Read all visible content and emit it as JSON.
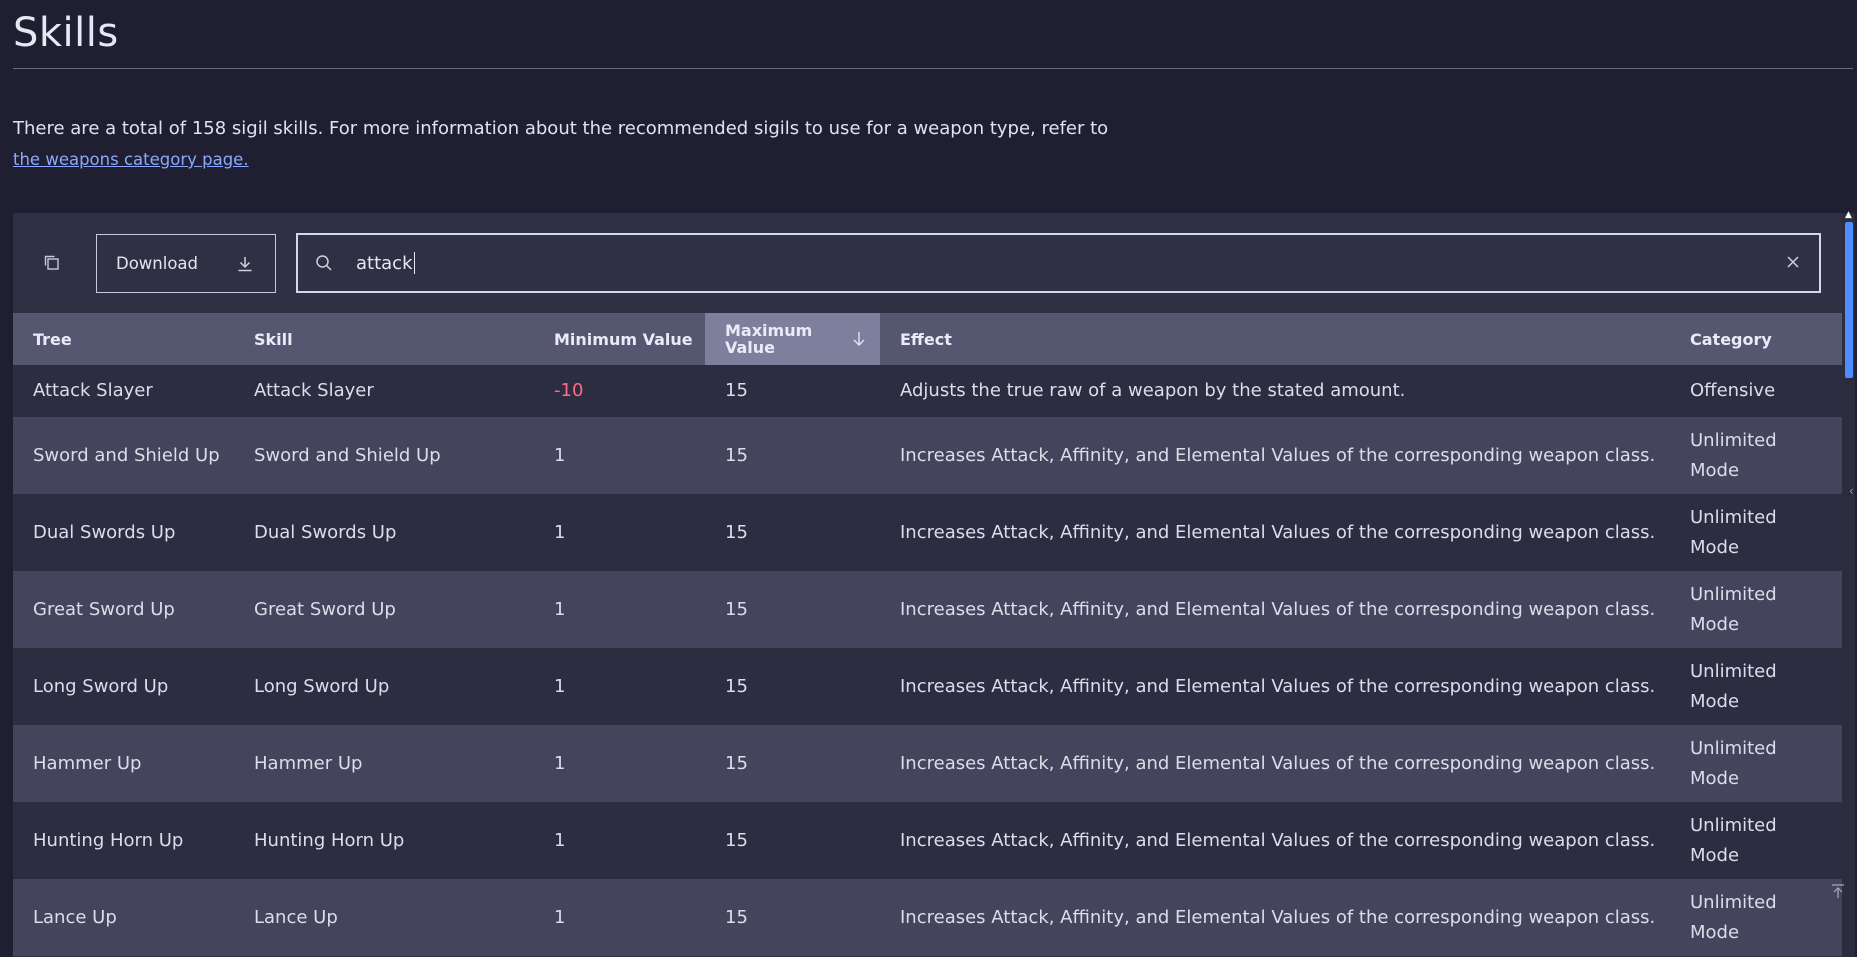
{
  "page": {
    "title": "Skills",
    "intro_text": "There are a total of 158 sigil skills. For more information about the recommended sigils to use for a weapon type, refer to",
    "intro_link": "the weapons category page."
  },
  "toolbar": {
    "download_label": "Download",
    "search_value": "attack"
  },
  "table": {
    "columns": [
      {
        "label": "Tree"
      },
      {
        "label": "Skill"
      },
      {
        "label": "Minimum Value"
      },
      {
        "label": "Maximum Value",
        "sorted": "descending"
      },
      {
        "label": "Effect"
      },
      {
        "label": "Category"
      }
    ],
    "rows": [
      {
        "tree": "Attack Slayer",
        "skill": "Attack Slayer",
        "min": "-10",
        "max": "15",
        "effect": "Adjusts the true raw of a weapon by the stated amount.",
        "category": "Offensive"
      },
      {
        "tree": "Sword and Shield Up",
        "skill": "Sword and Shield Up",
        "min": "1",
        "max": "15",
        "effect": "Increases Attack, Affinity, and Elemental Values of the corresponding weapon class.",
        "category": "Unlimited Mode"
      },
      {
        "tree": "Dual Swords Up",
        "skill": "Dual Swords Up",
        "min": "1",
        "max": "15",
        "effect": "Increases Attack, Affinity, and Elemental Values of the corresponding weapon class.",
        "category": "Unlimited Mode"
      },
      {
        "tree": "Great Sword Up",
        "skill": "Great Sword Up",
        "min": "1",
        "max": "15",
        "effect": "Increases Attack, Affinity, and Elemental Values of the corresponding weapon class.",
        "category": "Unlimited Mode"
      },
      {
        "tree": "Long Sword Up",
        "skill": "Long Sword Up",
        "min": "1",
        "max": "15",
        "effect": "Increases Attack, Affinity, and Elemental Values of the corresponding weapon class.",
        "category": "Unlimited Mode"
      },
      {
        "tree": "Hammer Up",
        "skill": "Hammer Up",
        "min": "1",
        "max": "15",
        "effect": "Increases Attack, Affinity, and Elemental Values of the corresponding weapon class.",
        "category": "Unlimited Mode"
      },
      {
        "tree": "Hunting Horn Up",
        "skill": "Hunting Horn Up",
        "min": "1",
        "max": "15",
        "effect": "Increases Attack, Affinity, and Elemental Values of the corresponding weapon class.",
        "category": "Unlimited Mode"
      },
      {
        "tree": "Lance Up",
        "skill": "Lance Up",
        "min": "1",
        "max": "15",
        "effect": "Increases Attack, Affinity, and Elemental Values of the corresponding weapon class.",
        "category": "Unlimited Mode"
      }
    ]
  },
  "colors": {
    "background": "#1f1f31",
    "table_header": "#555670",
    "sorted_header": "#7d7f9c",
    "negative_value": "#ff6b8a",
    "link": "#8aa8ff",
    "scroll_thumb": "#4e8dff"
  },
  "icons": {
    "copy": "copy-icon",
    "download": "download-icon",
    "search": "search-icon",
    "clear": "close-icon",
    "sort": "arrow-down-icon",
    "back_to_top": "back-to-top-icon"
  }
}
